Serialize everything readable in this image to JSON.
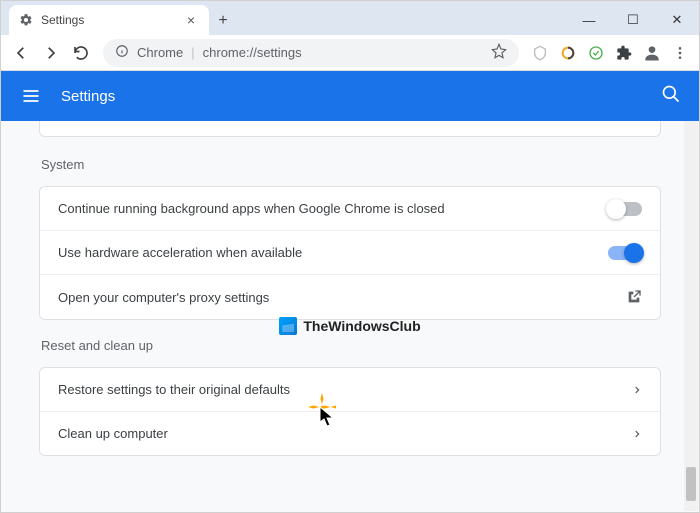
{
  "window": {
    "tab_title": "Settings",
    "minimize": "—",
    "maximize": "☐",
    "close": "✕",
    "new_tab": "+"
  },
  "toolbar": {
    "url_context": "Chrome",
    "url_separator": "|",
    "url": "chrome://settings"
  },
  "header": {
    "title": "Settings"
  },
  "sections": {
    "system": {
      "title": "System",
      "rows": [
        {
          "label": "Continue running background apps when Google Chrome is closed",
          "toggle": "off"
        },
        {
          "label": "Use hardware acceleration when available",
          "toggle": "on"
        },
        {
          "label": "Open your computer's proxy settings",
          "action": "open"
        }
      ]
    },
    "reset": {
      "title": "Reset and clean up",
      "rows": [
        {
          "label": "Restore settings to their original defaults",
          "action": "arrow"
        },
        {
          "label": "Clean up computer",
          "action": "arrow"
        }
      ]
    }
  },
  "watermark": {
    "text": "TheWindowsClub"
  }
}
